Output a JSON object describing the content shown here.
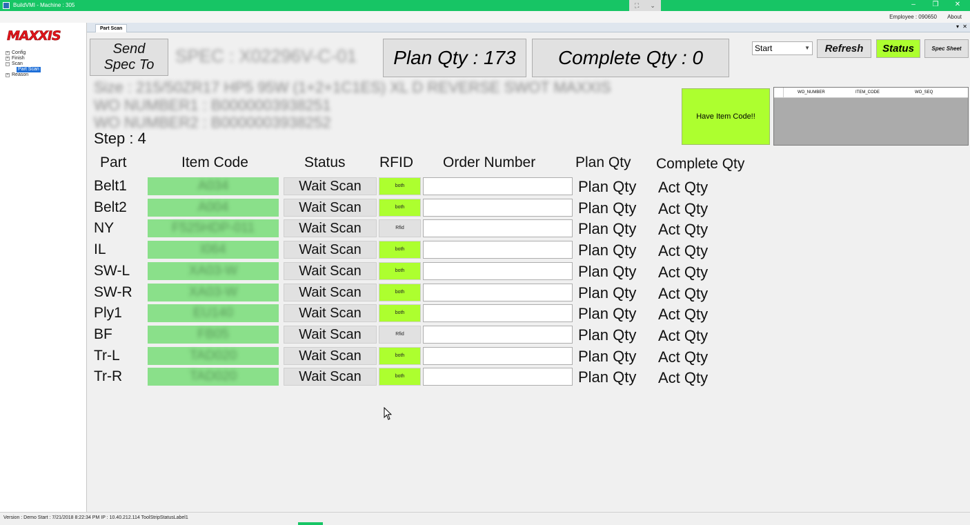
{
  "window": {
    "title": "BuildVMI - Machine : 305",
    "minimize": "–",
    "restore": "❐",
    "close": "✕"
  },
  "menubar": {
    "employee": "Employee : 090650",
    "about": "About"
  },
  "sidebar": {
    "logo": "MAXXIS",
    "tree": [
      {
        "label": "Config"
      },
      {
        "label": "Finish"
      },
      {
        "label": "Scan"
      },
      {
        "label": "Part Scan",
        "selected": true
      },
      {
        "label": "Reason"
      }
    ]
  },
  "tab": {
    "label": "Part Scan",
    "pin": "▾",
    "close": "✕"
  },
  "header": {
    "send_spec": "Send Spec To",
    "spec": "SPEC : X02296V-C-01",
    "plan_qty": "Plan Qty : 173",
    "complete_qty": "Complete Qty : 0",
    "select_value": "Start",
    "refresh": "Refresh",
    "status": "Status",
    "spec_sheet": "Spec Sheet"
  },
  "info": {
    "size": "Size : 215/50ZR17 HP5 95W (1+2+1C1ES) XL D REVERSE SWOT MAXXIS",
    "wo1": "WO NUMBER1 : B0000003938251",
    "wo2": "WO NUMBER2 : B0000003938252",
    "step": "Step : 4"
  },
  "have_item": "Have Item Code!!",
  "grid": {
    "columns": [
      "WO_NUMBER",
      "ITEM_CODE",
      "WO_SEQ"
    ]
  },
  "table": {
    "headers": {
      "part": "Part",
      "item_code": "Item Code",
      "status": "Status",
      "rfid": "RFID",
      "order_number": "Order Number",
      "plan_qty": "Plan Qty",
      "complete_qty": "Complete Qty"
    },
    "rows": [
      {
        "part": "Belt1",
        "code": "A034",
        "status": "Wait Scan",
        "rfid": "both",
        "plan": "Plan Qty",
        "act": "Act Qty"
      },
      {
        "part": "Belt2",
        "code": "A004",
        "status": "Wait Scan",
        "rfid": "both",
        "plan": "Plan Qty",
        "act": "Act Qty"
      },
      {
        "part": "NY",
        "code": "F525HDP-011",
        "status": "Wait Scan",
        "rfid": "Rfid",
        "plan": "Plan Qty",
        "act": "Act Qty"
      },
      {
        "part": "IL",
        "code": "I064",
        "status": "Wait Scan",
        "rfid": "both",
        "plan": "Plan Qty",
        "act": "Act Qty"
      },
      {
        "part": "SW-L",
        "code": "XA03-W",
        "status": "Wait Scan",
        "rfid": "both",
        "plan": "Plan Qty",
        "act": "Act Qty"
      },
      {
        "part": "SW-R",
        "code": "XA03-W",
        "status": "Wait Scan",
        "rfid": "both",
        "plan": "Plan Qty",
        "act": "Act Qty"
      },
      {
        "part": "Ply1",
        "code": "EU140",
        "status": "Wait Scan",
        "rfid": "both",
        "plan": "Plan Qty",
        "act": "Act Qty"
      },
      {
        "part": "BF",
        "code": "FB05",
        "status": "Wait Scan",
        "rfid": "Rfid",
        "plan": "Plan Qty",
        "act": "Act Qty"
      },
      {
        "part": "Tr-L",
        "code": "TAD020",
        "status": "Wait Scan",
        "rfid": "both",
        "plan": "Plan Qty",
        "act": "Act Qty"
      },
      {
        "part": "Tr-R",
        "code": "TAD020",
        "status": "Wait Scan",
        "rfid": "both",
        "plan": "Plan Qty",
        "act": "Act Qty"
      }
    ]
  },
  "statusbar": "Version : Demo  Start : 7/21/2018 8:22:34 PM  IP : 10.40.212.114  ToolStripStatusLabel1",
  "colors": {
    "titlebar": "#17c565",
    "accent_green": "#adff2f",
    "item_code_bg": "#8ae08a",
    "logo_red": "#e3151b"
  }
}
